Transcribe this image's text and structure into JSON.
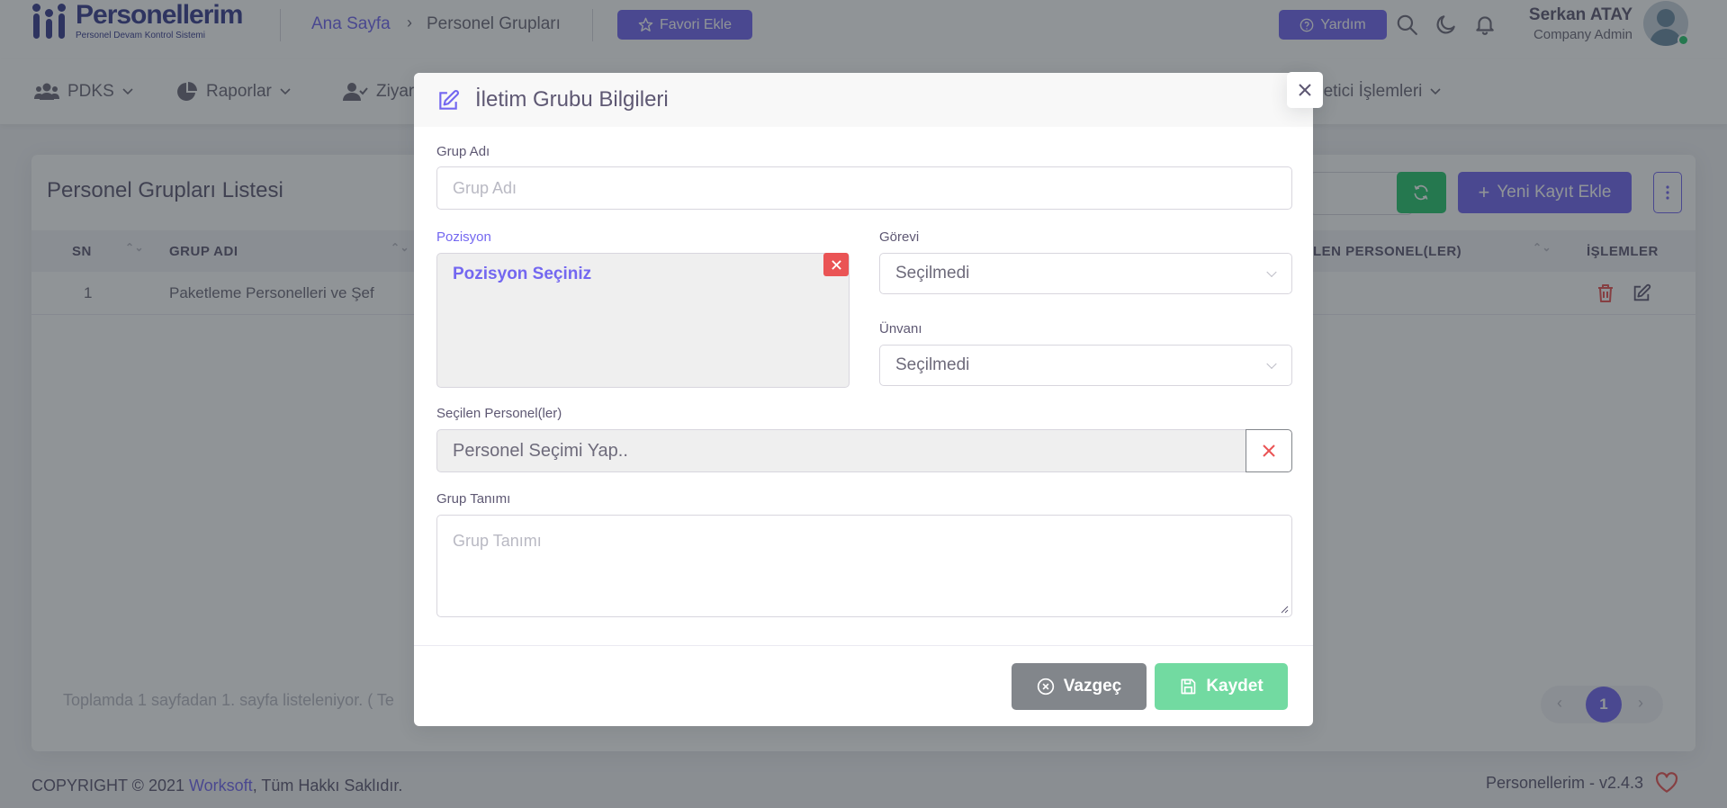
{
  "brand": {
    "title": "Personellerim",
    "subtitle": "Personel Devam Kontrol Sistemi",
    "color": "#3b3e91"
  },
  "breadcrumb": {
    "home": "Ana Sayfa",
    "current": "Personel Grupları"
  },
  "header": {
    "favorite_label": "Favori Ekle",
    "help_label": "Yardım",
    "user_name": "Serkan ATAY",
    "user_role": "Company Admin",
    "icons": [
      "search-icon",
      "moon-icon",
      "bell-icon"
    ]
  },
  "menu": {
    "items": [
      {
        "label": "PDKS",
        "icon": "users-icon"
      },
      {
        "label": "Raporlar",
        "icon": "pie-chart-icon"
      },
      {
        "label": "Ziyar",
        "icon": "user-check-icon"
      },
      {
        "label": "netici İşlemleri",
        "icon": ""
      }
    ]
  },
  "card": {
    "title": "Personel Grupları Listesi",
    "new_record_label": "Yeni Kayıt Ekle",
    "columns": [
      "SN",
      "GRUP ADI",
      "LEN PERSONEL(LER)",
      "İŞLEMLER"
    ],
    "rows": [
      {
        "sn": "1",
        "group_name": "Paketleme Personelleri ve Şef"
      }
    ],
    "pager_text": "Toplamda 1 sayfadan 1. sayfa listeleniyor. ( Te",
    "current_page": "1"
  },
  "footer": {
    "copyright_prefix": "COPYRIGHT © 2021 ",
    "company": "Worksoft",
    "copyright_suffix": ", Tüm Hakkı Saklıdır.",
    "version": "Personellerim - v2.4.3"
  },
  "modal": {
    "title": "İletim Grubu Bilgileri",
    "group_name_label": "Grup Adı",
    "group_name_placeholder": "Grup Adı",
    "position_label": "Pozisyon",
    "position_placeholder": "Pozisyon Seçiniz",
    "duty_label": "Görevi",
    "duty_value": "Seçilmedi",
    "title_label": "Ünvanı",
    "title_value": "Seçilmedi",
    "selected_staff_label": "Seçilen Personel(ler)",
    "selected_staff_placeholder": "Personel Seçimi Yap..",
    "group_desc_label": "Grup Tanımı",
    "group_desc_placeholder": "Grup Tanımı",
    "cancel_label": "Vazgeç",
    "save_label": "Kaydet"
  },
  "colors": {
    "primary": "#7367f0",
    "success": "#28c76f",
    "danger": "#ea5455",
    "secondary": "#82868b"
  }
}
